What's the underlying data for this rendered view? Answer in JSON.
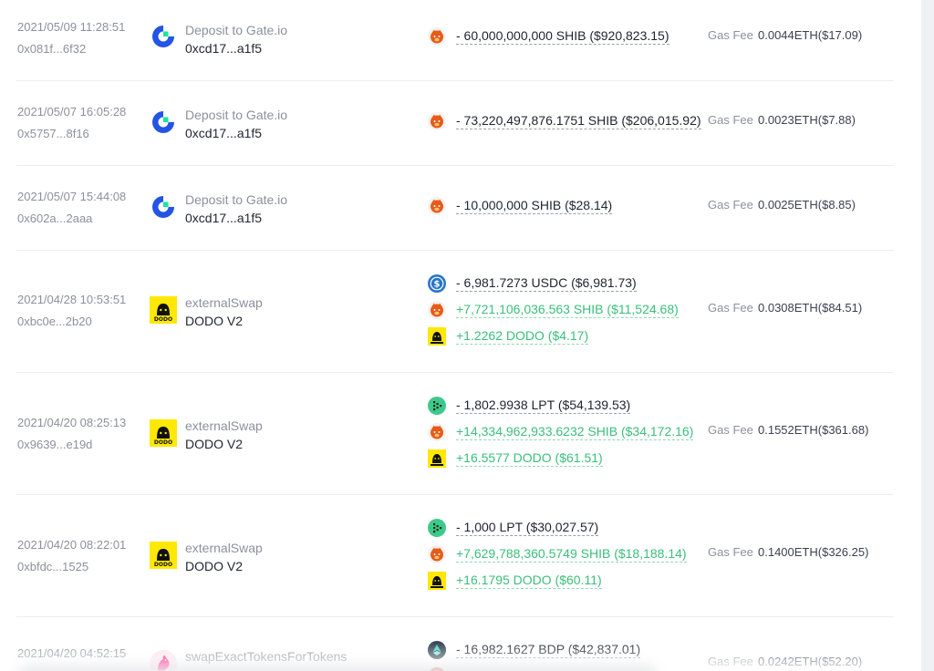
{
  "colors": {
    "accent_positive": "#3bbf7a",
    "text_muted": "#8b919c",
    "text_main": "#1f2430"
  },
  "transactions": [
    {
      "time": "2021/05/09 11:28:51",
      "hash": "0x081f...6f32",
      "protocol_icon": "gate-io-logo",
      "method": "Deposit to Gate.io",
      "target": "0xcd17...a1f5",
      "transfers": [
        {
          "token_icon": "shib-icon",
          "text": "- 60,000,000,000 SHIB ($920,823.15)",
          "direction": "out"
        }
      ],
      "gas_label": "Gas Fee",
      "gas_fee": "0.0044ETH($17.09)"
    },
    {
      "time": "2021/05/07 16:05:28",
      "hash": "0x5757...8f16",
      "protocol_icon": "gate-io-logo",
      "method": "Deposit to Gate.io",
      "target": "0xcd17...a1f5",
      "transfers": [
        {
          "token_icon": "shib-icon",
          "text": "- 73,220,497,876.1751 SHIB ($206,015.92)",
          "direction": "out"
        }
      ],
      "gas_label": "Gas Fee",
      "gas_fee": "0.0023ETH($7.88)"
    },
    {
      "time": "2021/05/07 15:44:08",
      "hash": "0x602a...2aaa",
      "protocol_icon": "gate-io-logo",
      "method": "Deposit to Gate.io",
      "target": "0xcd17...a1f5",
      "transfers": [
        {
          "token_icon": "shib-icon",
          "text": "- 10,000,000 SHIB ($28.14)",
          "direction": "out"
        }
      ],
      "gas_label": "Gas Fee",
      "gas_fee": "0.0025ETH($8.85)"
    },
    {
      "time": "2021/04/28 10:53:51",
      "hash": "0xbc0e...2b20",
      "protocol_icon": "dodo-logo",
      "protocol_icon_text": "DODO",
      "method": "externalSwap",
      "target": "DODO V2",
      "transfers": [
        {
          "token_icon": "usdc-icon",
          "text": "- 6,981.7273 USDC ($6,981.73)",
          "direction": "out"
        },
        {
          "token_icon": "shib-icon",
          "text": "+7,721,106,036.563 SHIB ($11,524.68)",
          "direction": "in"
        },
        {
          "token_icon": "dodo-icon",
          "text": "+1.2262 DODO ($4.17)",
          "direction": "in"
        }
      ],
      "gas_label": "Gas Fee",
      "gas_fee": "0.0308ETH($84.51)"
    },
    {
      "time": "2021/04/20 08:25:13",
      "hash": "0x9639...e19d",
      "protocol_icon": "dodo-logo",
      "protocol_icon_text": "DODO",
      "method": "externalSwap",
      "target": "DODO V2",
      "transfers": [
        {
          "token_icon": "lpt-icon",
          "text": "- 1,802.9938 LPT ($54,139.53)",
          "direction": "out"
        },
        {
          "token_icon": "shib-icon",
          "text": "+14,334,962,933.6232 SHIB ($34,172.16)",
          "direction": "in"
        },
        {
          "token_icon": "dodo-icon",
          "text": "+16.5577 DODO ($61.51)",
          "direction": "in"
        }
      ],
      "gas_label": "Gas Fee",
      "gas_fee": "0.1552ETH($361.68)"
    },
    {
      "time": "2021/04/20 08:22:01",
      "hash": "0xbfdc...1525",
      "protocol_icon": "dodo-logo",
      "protocol_icon_text": "DODO",
      "method": "externalSwap",
      "target": "DODO V2",
      "transfers": [
        {
          "token_icon": "lpt-icon",
          "text": "- 1,000 LPT ($30,027.57)",
          "direction": "out"
        },
        {
          "token_icon": "shib-icon",
          "text": "+7,629,788,360.5749 SHIB ($18,188.14)",
          "direction": "in"
        },
        {
          "token_icon": "dodo-icon",
          "text": "+16.1795 DODO ($60.11)",
          "direction": "in"
        }
      ],
      "gas_label": "Gas Fee",
      "gas_fee": "0.1400ETH($326.25)"
    },
    {
      "time": "2021/04/20 04:52:15",
      "hash": "",
      "protocol_icon": "uniswap-logo",
      "method": "swapExactTokensForTokens",
      "target": "",
      "transfers": [
        {
          "token_icon": "bdp-icon",
          "text": "- 16,982.1627 BDP ($42,837.01)",
          "direction": "out"
        }
      ],
      "gas_label": "Gas Fee",
      "gas_fee": "0.0242ETH($52.20)"
    }
  ]
}
